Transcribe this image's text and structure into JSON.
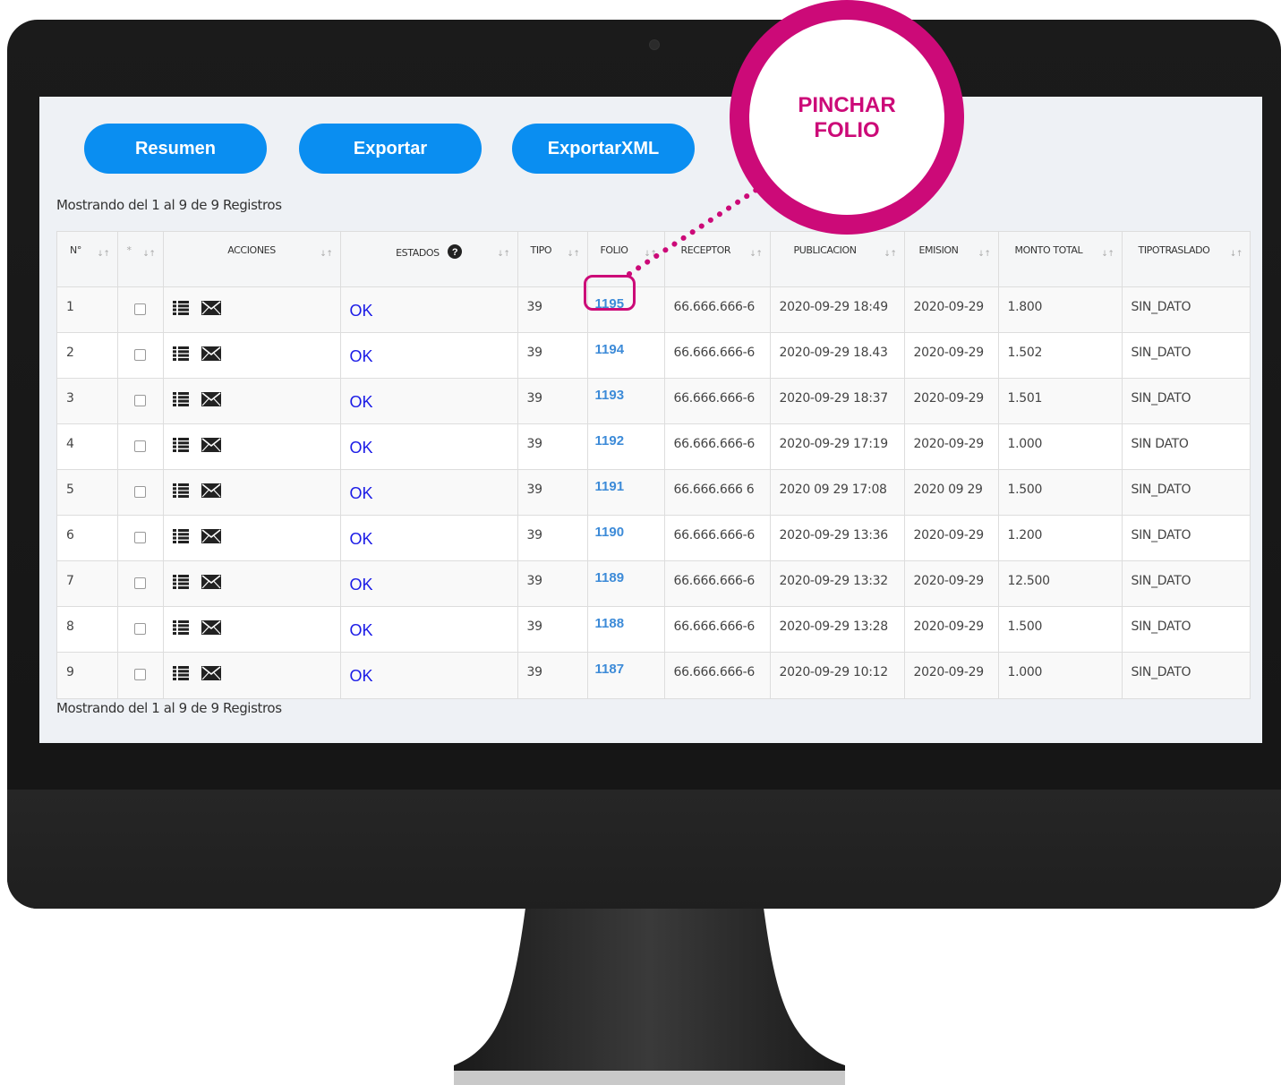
{
  "toolbar": {
    "resumen_label": "Resumen",
    "exportar_label": "Exportar",
    "exportarxml_label": "ExportarXML"
  },
  "info_top": "Mostrando del 1 al 9 de 9 Registros",
  "info_bottom": "Mostrando del 1 al 9 de 9 Registros",
  "table": {
    "headers": [
      "N°",
      "*",
      "ACCIONES",
      "ESTADOS",
      "TIPO",
      "FOLIO",
      "RECEPTOR",
      "PUBLICACION",
      "EMISION",
      "MONTO TOTAL",
      "TIPOTRASLADO"
    ],
    "rows": [
      {
        "n": "1",
        "estado": "OK",
        "tipo": "39",
        "folio": "1195",
        "receptor": "66.666.666-6",
        "publicacion": "2020-09-29 18:49",
        "emision": "2020-09-29",
        "monto": "1.800",
        "tipotraslado": "SIN_DATO"
      },
      {
        "n": "2",
        "estado": "OK",
        "tipo": "39",
        "folio": "1194",
        "receptor": "66.666.666-6",
        "publicacion": "2020-09-29 18.43",
        "emision": "2020-09-29",
        "monto": "1.502",
        "tipotraslado": "SIN_DATO"
      },
      {
        "n": "3",
        "estado": "OK",
        "tipo": "39",
        "folio": "1193",
        "receptor": "66.666.666-6",
        "publicacion": "2020-09-29 18:37",
        "emision": "2020-09-29",
        "monto": "1.501",
        "tipotraslado": "SIN_DATO"
      },
      {
        "n": "4",
        "estado": "OK",
        "tipo": "39",
        "folio": "1192",
        "receptor": "66.666.666-6",
        "publicacion": "2020-09-29 17:19",
        "emision": "2020-09-29",
        "monto": "1.000",
        "tipotraslado": "SIN DATO"
      },
      {
        "n": "5",
        "estado": "OK",
        "tipo": "39",
        "folio": "1191",
        "receptor": "66.666.666 6",
        "publicacion": "2020 09 29 17:08",
        "emision": "2020 09 29",
        "monto": "1.500",
        "tipotraslado": "SIN_DATO"
      },
      {
        "n": "6",
        "estado": "OK",
        "tipo": "39",
        "folio": "1190",
        "receptor": "66.666.666-6",
        "publicacion": "2020-09-29 13:36",
        "emision": "2020-09-29",
        "monto": "1.200",
        "tipotraslado": "SIN_DATO"
      },
      {
        "n": "7",
        "estado": "OK",
        "tipo": "39",
        "folio": "1189",
        "receptor": "66.666.666-6",
        "publicacion": "2020-09-29 13:32",
        "emision": "2020-09-29",
        "monto": "12.500",
        "tipotraslado": "SIN_DATO"
      },
      {
        "n": "8",
        "estado": "OK",
        "tipo": "39",
        "folio": "1188",
        "receptor": "66.666.666-6",
        "publicacion": "2020-09-29 13:28",
        "emision": "2020-09-29",
        "monto": "1.500",
        "tipotraslado": "SIN_DATO"
      },
      {
        "n": "9",
        "estado": "OK",
        "tipo": "39",
        "folio": "1187",
        "receptor": "66.666.666-6",
        "publicacion": "2020-09-29 10:12",
        "emision": "2020-09-29",
        "monto": "1.000",
        "tipotraslado": "SIN_DATO"
      }
    ]
  },
  "annotation": {
    "text_line1": "PINCHAR",
    "text_line2": "FOLIO"
  },
  "colors": {
    "button": "#0a8ef1",
    "accent": "#cc0a78",
    "ok": "#1a1ae6",
    "folio_link": "#3d8bd8"
  },
  "icons": {
    "actions": [
      "list-icon",
      "mail-icon"
    ],
    "estados_help": "question-circle-icon",
    "sort": "sort-icon"
  }
}
